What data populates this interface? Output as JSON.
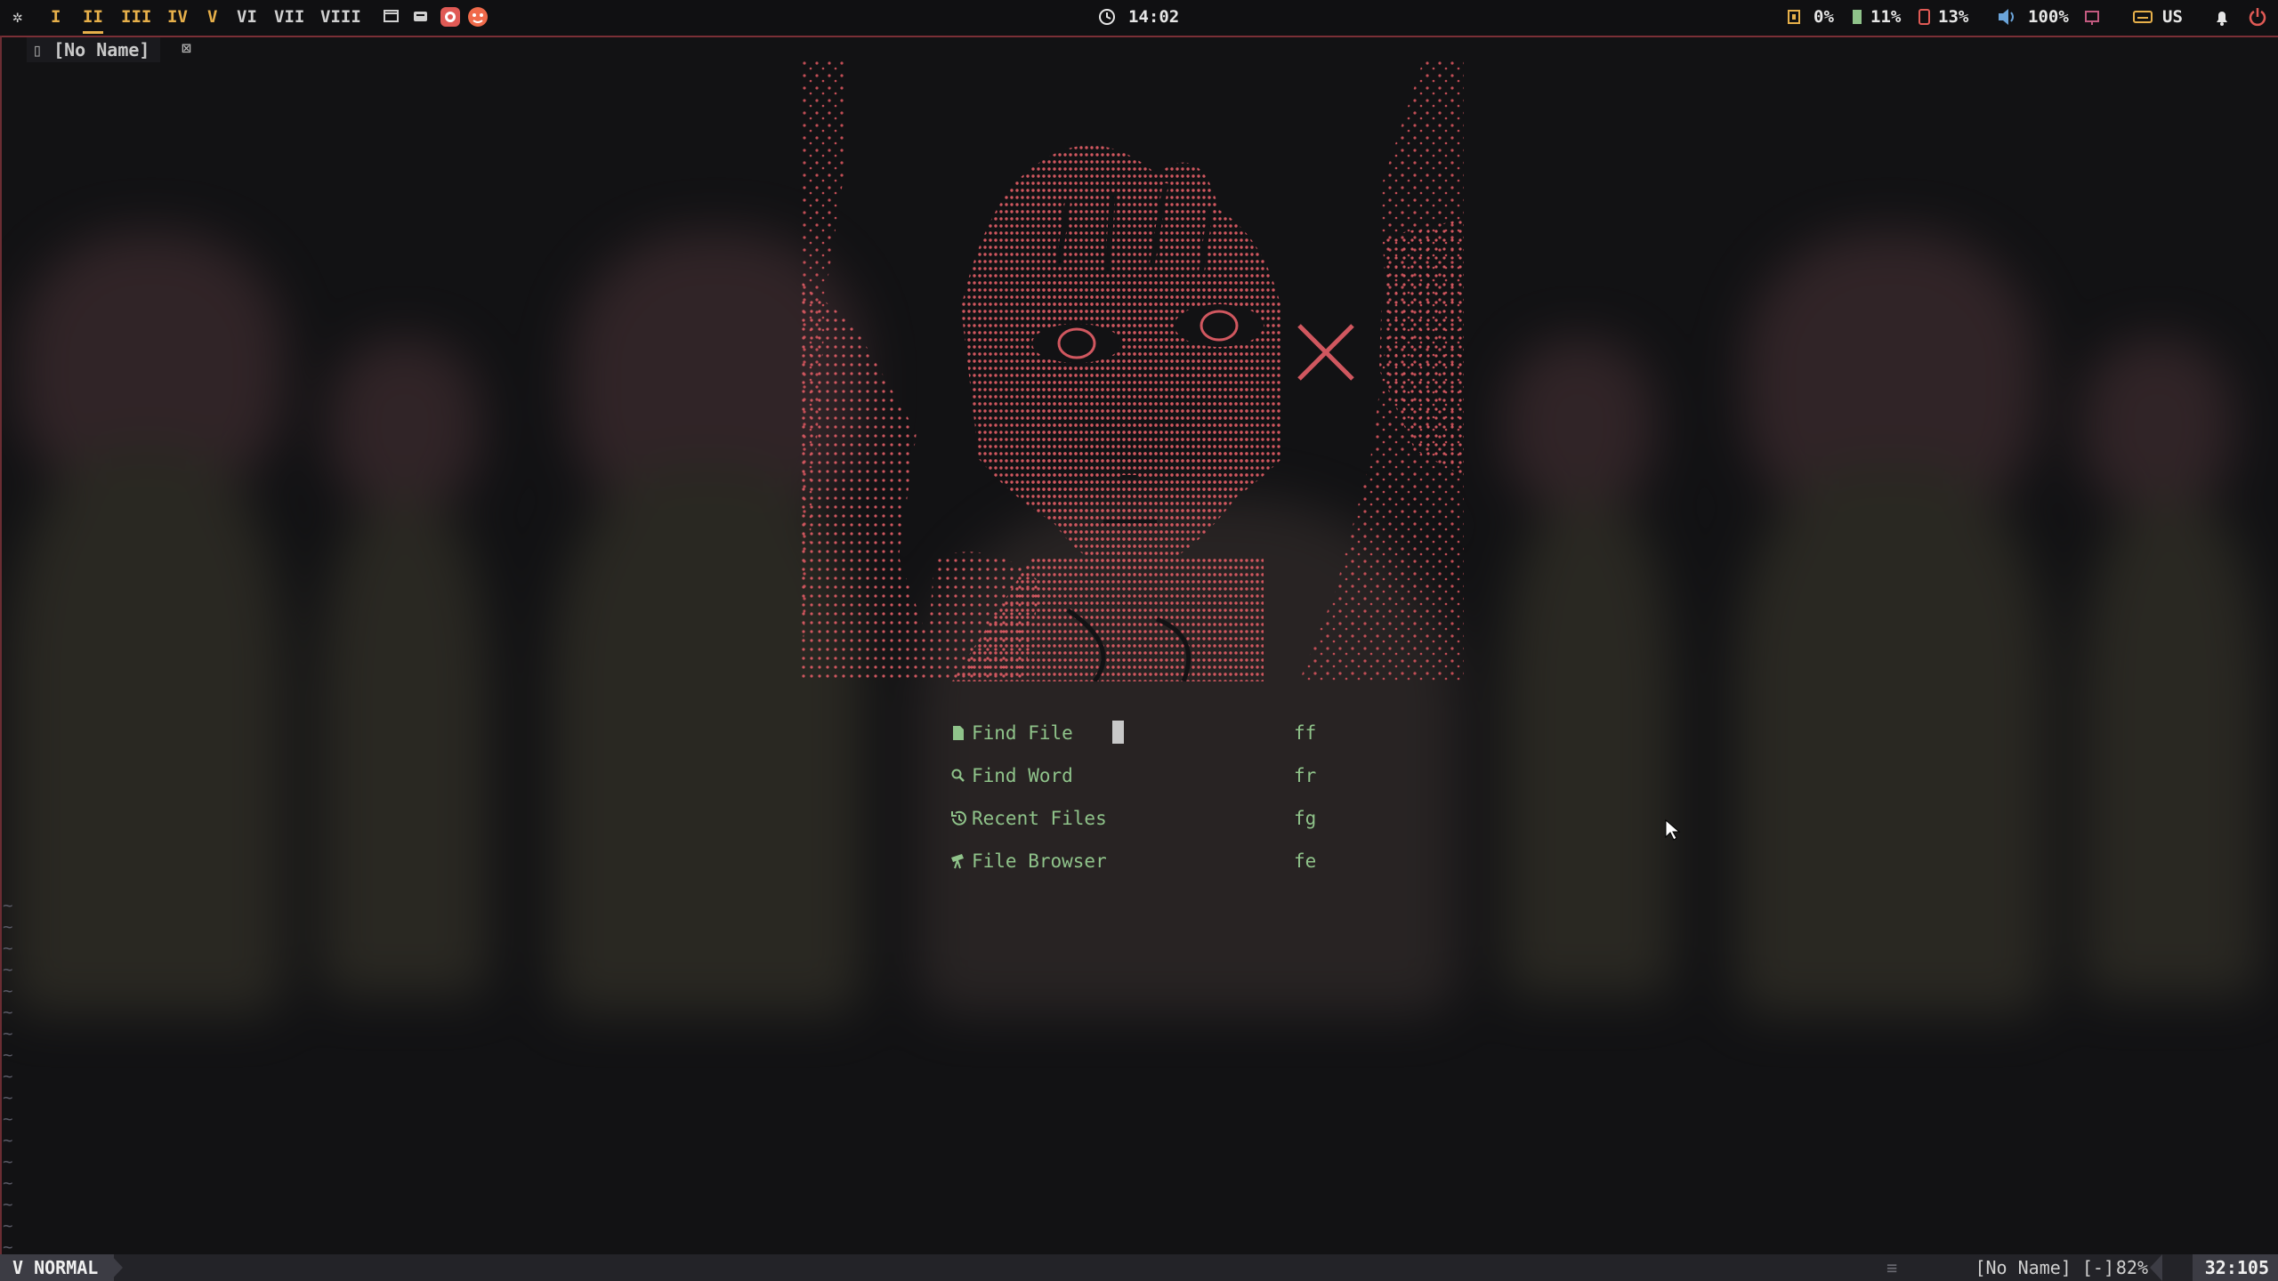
{
  "topbar": {
    "workspaces": [
      "I",
      "II",
      "III",
      "IV",
      "V",
      "VI",
      "VII",
      "VIII"
    ],
    "active_workspace": "II",
    "clock": "14:02",
    "cpu": "0%",
    "memory": "11%",
    "disk": "13%",
    "volume": "100%",
    "keyboard_layout": "US"
  },
  "buffer_tab": {
    "label": "[No Name]"
  },
  "dashboard": {
    "items": [
      {
        "label": "Find File",
        "key": "ff",
        "icon": "file-icon"
      },
      {
        "label": "Find Word",
        "key": "fr",
        "icon": "search-icon"
      },
      {
        "label": "Recent Files",
        "key": "fg",
        "icon": "history-icon"
      },
      {
        "label": "File Browser",
        "key": "fe",
        "icon": "telescope-icon"
      }
    ]
  },
  "statusline": {
    "mode": "NORMAL",
    "file": "[No Name] [-]",
    "percent": "82%",
    "position": "32:105"
  },
  "colors": {
    "accent": "#e7b04a",
    "menu_text": "#8fc38a",
    "art": "#d0575f",
    "border": "#7a2f36"
  }
}
